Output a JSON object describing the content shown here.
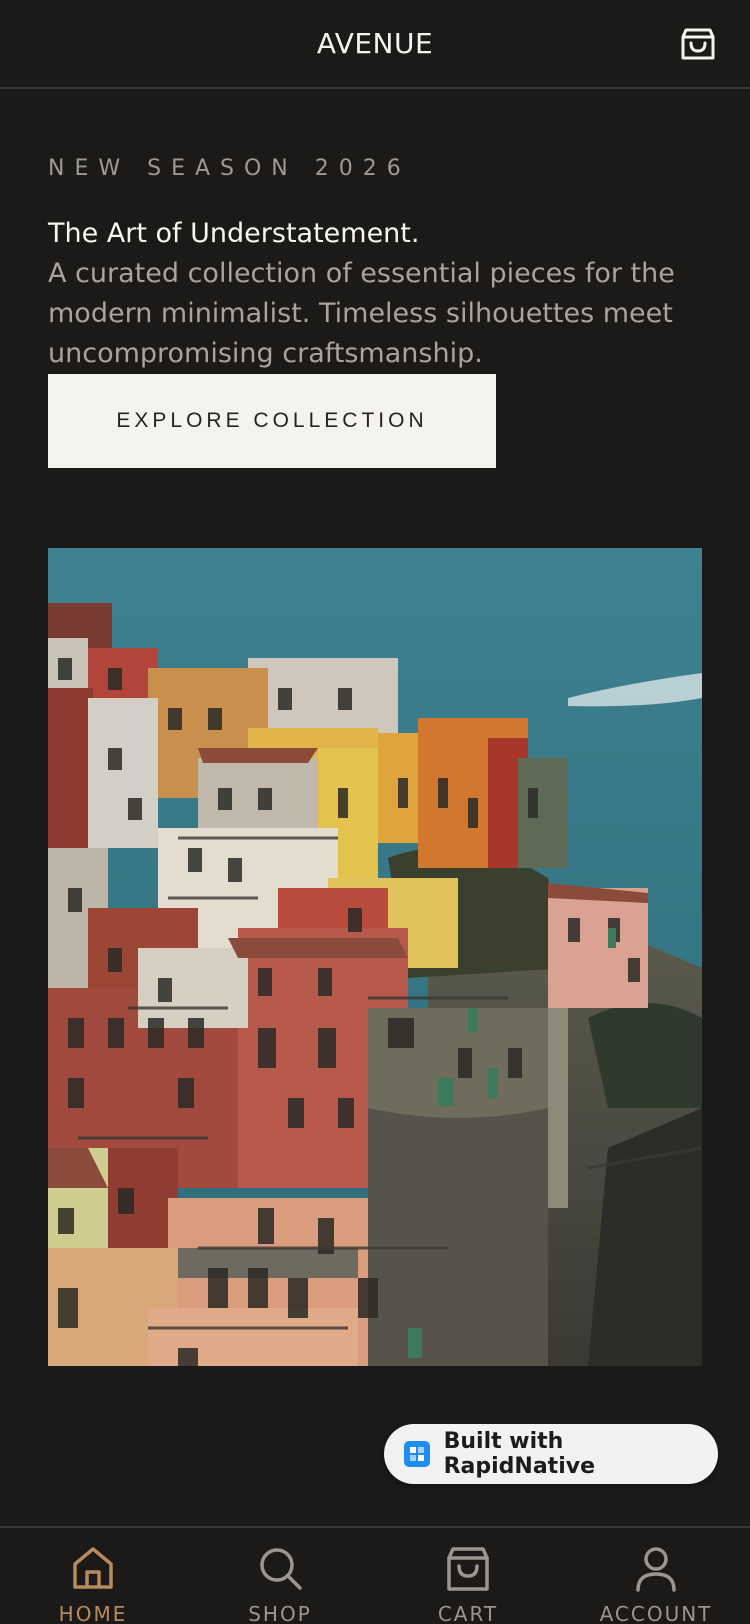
{
  "header": {
    "brand": "AVENUE",
    "cart_icon": "shopping-bag-icon"
  },
  "hero": {
    "eyebrow": "NEW SEASON 2026",
    "headline": "The Art of Understatement.",
    "description": "A curated collection of essential pieces for the modern minimalist. Timeless silhouettes meet uncompromising craftsmanship.",
    "cta_label": "EXPLORE COLLECTION"
  },
  "badge": {
    "label": "Built with RapidNative",
    "icon": "rapidnative-logo-icon"
  },
  "tabs": [
    {
      "label": "HOME",
      "icon": "home-icon",
      "active": true
    },
    {
      "label": "SHOP",
      "icon": "search-icon",
      "active": false
    },
    {
      "label": "CART",
      "icon": "shopping-bag-icon",
      "active": false
    },
    {
      "label": "ACCOUNT",
      "icon": "user-icon",
      "active": false
    }
  ],
  "colors": {
    "background": "#1b1a19",
    "accent": "#b88a5e",
    "button_bg": "#f5f3ee",
    "muted_text": "#a7a39d"
  }
}
